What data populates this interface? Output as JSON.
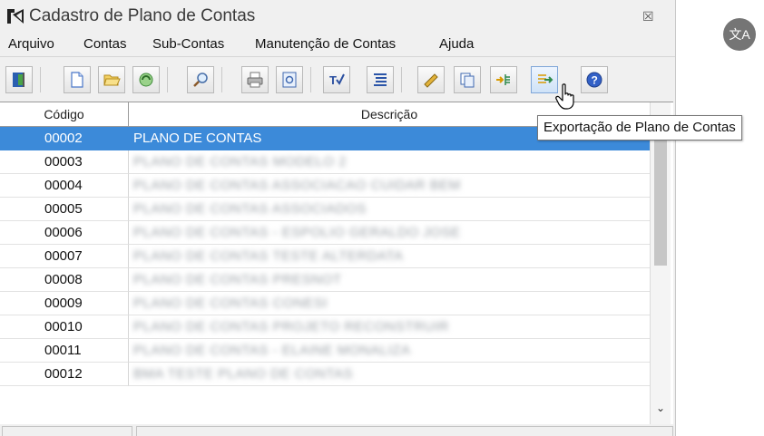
{
  "window": {
    "title": "Cadastro de Plano de Contas",
    "close_glyph": "☒"
  },
  "menu": [
    "Arquivo",
    "Contas",
    "Sub-Contas",
    "Manutenção de Contas",
    "Ajuda"
  ],
  "toolbar": {
    "buttons": [
      "exit-door-icon",
      "new-document-icon",
      "open-folder-icon",
      "refresh-icon",
      "search-icon",
      "print-icon",
      "preview-icon",
      "edit-check-icon",
      "list-icon",
      "ruler-icon",
      "copy-icon",
      "import-icon",
      "export-icon",
      "help-icon"
    ]
  },
  "grid": {
    "columns": [
      "Código",
      "Descrição"
    ],
    "rows": [
      {
        "codigo": "00002",
        "descricao": "PLANO DE CONTAS",
        "selected": true,
        "blurred": false
      },
      {
        "codigo": "00003",
        "descricao": "PLANO DE CONTAS MODELO 2",
        "selected": false,
        "blurred": true
      },
      {
        "codigo": "00004",
        "descricao": "PLANO DE CONTAS ASSOCIACAO CUIDAR BEM",
        "selected": false,
        "blurred": true
      },
      {
        "codigo": "00005",
        "descricao": "PLANO DE CONTAS ASSOCIADOS",
        "selected": false,
        "blurred": true
      },
      {
        "codigo": "00006",
        "descricao": "PLANO DE CONTAS - ESPOLIO GERALDO JOSE",
        "selected": false,
        "blurred": true
      },
      {
        "codigo": "00007",
        "descricao": "PLANO DE CONTAS TESTE ALTERDATA",
        "selected": false,
        "blurred": true
      },
      {
        "codigo": "00008",
        "descricao": "PLANO DE CONTAS PRESNOT",
        "selected": false,
        "blurred": true
      },
      {
        "codigo": "00009",
        "descricao": "PLANO DE CONTAS CONESI",
        "selected": false,
        "blurred": true
      },
      {
        "codigo": "00010",
        "descricao": "PLANO DE CONTAS PROJETO RECONSTRUIR",
        "selected": false,
        "blurred": true
      },
      {
        "codigo": "00011",
        "descricao": "PLANO DE CONTAS - ELAINE MONALIZA",
        "selected": false,
        "blurred": true
      },
      {
        "codigo": "00012",
        "descricao": "BMA TESTE PLANO DE CONTAS",
        "selected": false,
        "blurred": true
      }
    ]
  },
  "tooltip": "Exportação de Plano de Contas",
  "translate_button": {
    "label": "文A"
  },
  "colors": {
    "selection": "#3c8ad9",
    "window_bg": "#f0f0f0"
  }
}
